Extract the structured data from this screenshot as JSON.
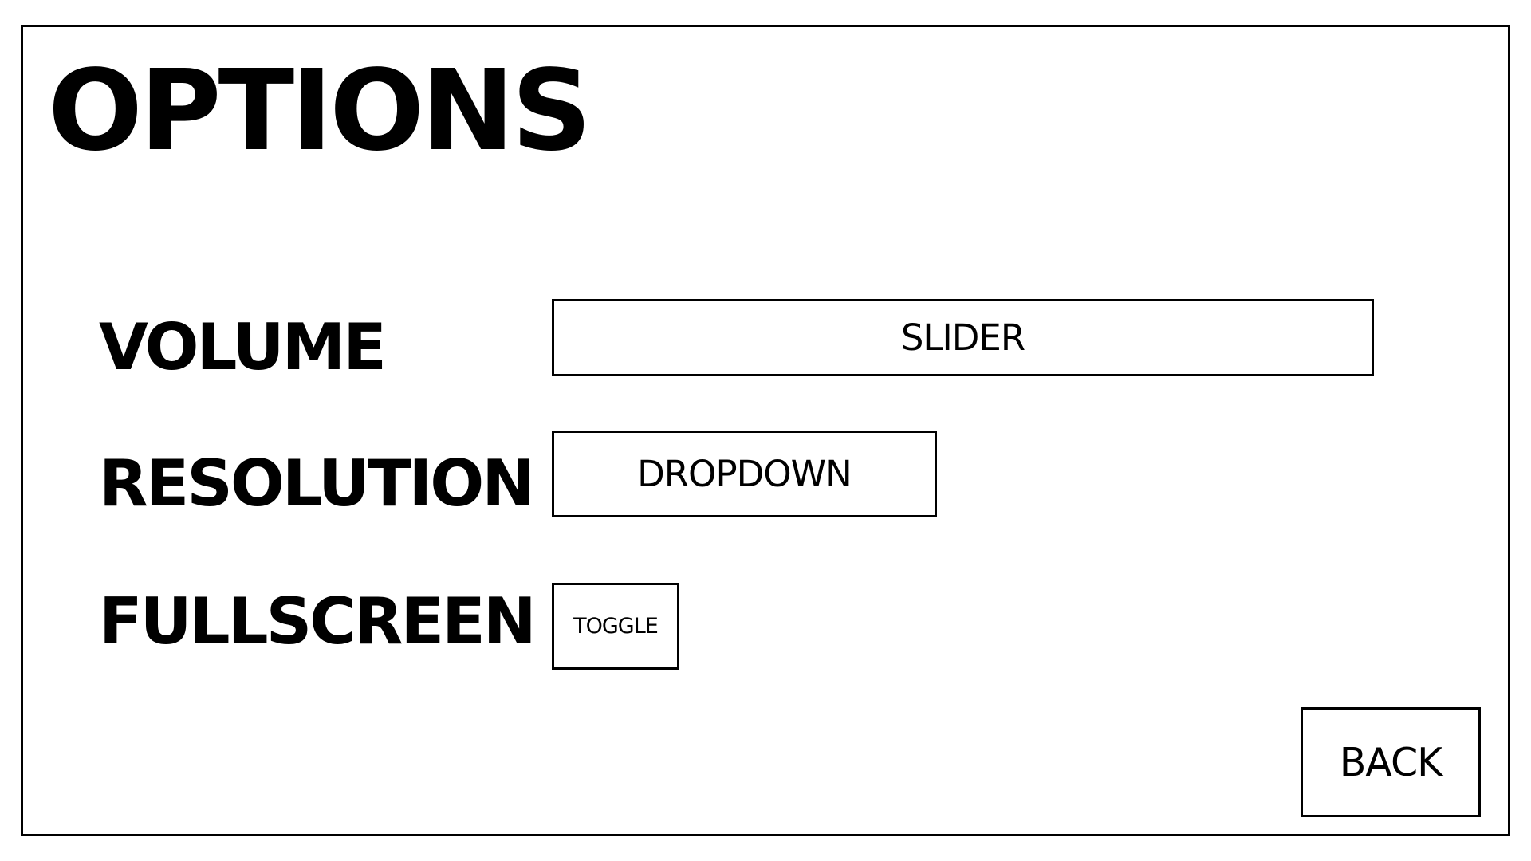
{
  "title": "OPTIONS",
  "settings": [
    {
      "label": "VOLUME",
      "control": "SLIDER"
    },
    {
      "label": "RESOLUTION",
      "control": "DROPDOWN"
    },
    {
      "label": "FULLSCREEN",
      "control": "TOGGLE"
    }
  ],
  "back_label": "BACK"
}
